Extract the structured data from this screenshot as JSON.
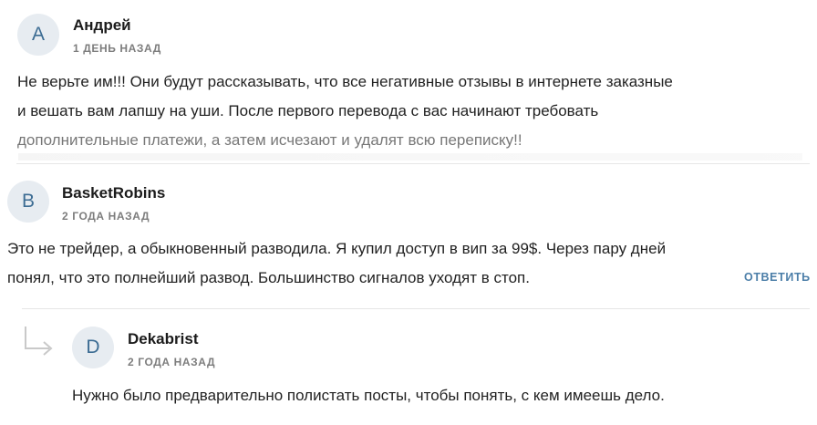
{
  "comments": [
    {
      "avatar_letter": "А",
      "author": "Андрей",
      "date": "1 ДЕНЬ НАЗАД",
      "lines": [
        "Не верьте им!!! Они будут рассказывать, что все негативные отзывы в интернете заказные",
        "и вешать вам лапшу на уши. После первого перевода с вас начинают требовать",
        "дополнительные платежи, а затем исчезают и удалят всю переписку!!"
      ]
    },
    {
      "avatar_letter": "B",
      "author": "BasketRobins",
      "date": "2 ГОДА НАЗАД",
      "lines": [
        "Это не трейдер, а обыкновенный разводила. Я купил доступ в вип за 99$. Через пару дней",
        "понял, что это полнейший развод. Большинство сигналов уходят в стоп."
      ],
      "reply_label": "ОТВЕТИТЬ"
    },
    {
      "avatar_letter": "D",
      "author": "Dekabrist",
      "date": "2 ГОДА НАЗАД",
      "lines": [
        "Нужно было предварительно полистать посты, чтобы понять, с кем имеешь дело."
      ]
    }
  ]
}
